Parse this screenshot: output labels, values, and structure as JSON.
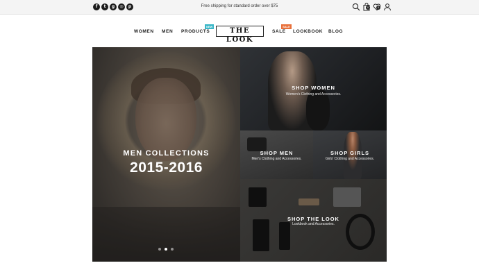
{
  "topbar": {
    "socials": [
      {
        "icon": "facebook-icon",
        "glyph": "f"
      },
      {
        "icon": "twitter-icon",
        "glyph": "t"
      },
      {
        "icon": "google-plus-icon",
        "glyph": "g"
      },
      {
        "icon": "instagram-icon",
        "glyph": "◎"
      },
      {
        "icon": "pinterest-icon",
        "glyph": "p"
      }
    ],
    "shipping_text": "Free shipping for standard order over $75",
    "tools": [
      "search-icon",
      "bag-icon",
      "wishlist-icon",
      "user-icon"
    ],
    "cart_count": "0",
    "wishlist_count": "0"
  },
  "nav": {
    "women": "WOMEN",
    "men": "MEN",
    "products": "PRODUCTS",
    "products_badge": "NEW",
    "logo": "THE LOOK",
    "sale": "SALE",
    "sale_badge": "SALE",
    "lookbook": "LOOKBOOK",
    "blog": "BLOG"
  },
  "hero": {
    "subtitle": "MEN COLLECTIONS",
    "title": "2015-2016",
    "slide_count": 3,
    "active_slide": 2
  },
  "tiles": {
    "women": {
      "title": "SHOP WOMEN",
      "subtitle": "Women's Clothing and Accessories."
    },
    "men": {
      "title": "SHOP MEN",
      "subtitle": "Men's Clothing and Accessories."
    },
    "girls": {
      "title": "SHOP GIRLS",
      "subtitle": "Girls' Clothing and Accessories."
    },
    "look": {
      "title": "SHOP THE LOOK",
      "subtitle": "Lookbook and Accessories."
    }
  },
  "colors": {
    "badge_new": "#39b6c7",
    "badge_sale": "#e8703a",
    "text": "#222222"
  }
}
